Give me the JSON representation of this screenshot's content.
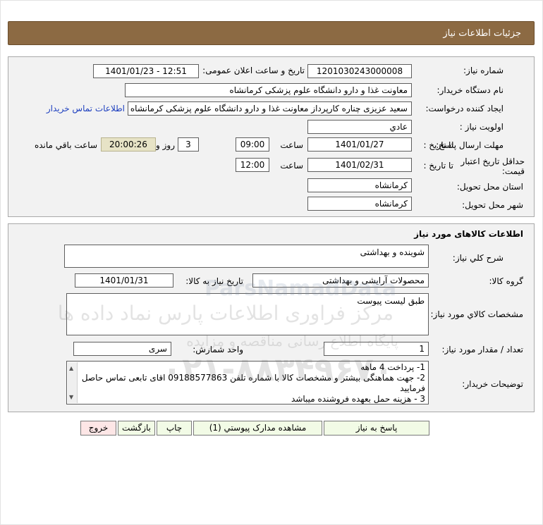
{
  "header": {
    "title": "جزئیات اطلاعات نیاز"
  },
  "info": {
    "need_number_label": "شماره نیاز:",
    "need_number": "1201030243000008",
    "announce_label": "تاریخ و ساعت اعلان عمومی:",
    "announce_value": "1401/01/23 - 12:51",
    "buyer_label": "نام دستگاه خریدار:",
    "buyer": "معاونت غذا و دارو دانشگاه علوم پزشکی کرمانشاه",
    "creator_label": "ایجاد کننده درخواست:",
    "creator": "سعید عزیزی چناره کارپرداز معاونت غذا و دارو دانشگاه علوم پزشکی کرمانشاه",
    "contact_link": "اطلاعات تماس خریدار",
    "priority_label": "اولویت نیاز :",
    "priority": "عادي",
    "deadline_label": "مهلت ارسال پاسخ:",
    "to_date_label": "تا تاریخ :",
    "deadline_date": "1401/01/27",
    "time_label": "ساعت",
    "deadline_time": "09:00",
    "days_value": "3",
    "days_label": "روز و",
    "remaining_time": "20:00:26",
    "remaining_label": "ساعت باقي مانده",
    "validity_label_1": "حداقل تاریخ اعتبار",
    "validity_label_2": "قیمت:",
    "validity_to_label": "تا تاریخ :",
    "validity_date": "1401/02/31",
    "validity_time_label": "ساعت",
    "validity_time": "12:00",
    "province_label": "استان محل تحویل:",
    "province": "کرمانشاه",
    "city_label": "شهر محل تحویل:",
    "city": "کرمانشاه"
  },
  "goods": {
    "title": "اطلاعات کالاهای مورد نیاز",
    "summary_label": "شرح کلي نیاز:",
    "summary": "شوینده و بهداشتی",
    "group_label": "گروه کالا:",
    "group": "محصولات آرایشی و بهداشتی",
    "need_date_label": "تاریخ نیاز به کالا:",
    "need_date": "1401/01/31",
    "specs_label": "مشخصات کالاي مورد نیاز:",
    "specs": "طبق لیست پیوست",
    "qty_label": "تعداد / مقدار مورد نیاز:",
    "qty": "1",
    "unit_label": "واحد شمارش:",
    "unit": "سری",
    "notes_label": "توضیحات خریدار:",
    "notes": [
      "1- پرداخت 4 ماهه",
      "2- جهت هماهنگی بیشتر و مشخصات کالا با شماره تلفن 09188577863 اقای تابعی  تماس حاصل فرمایید",
      "3 - هزینه حمل بعهده فروشنده میباشد"
    ]
  },
  "buttons": {
    "reply": "پاسخ به نیاز",
    "attachments": "مشاهده مدارک پیوستي (1)",
    "print": "چاپ",
    "back": "بازگشت",
    "exit": "خروج"
  },
  "watermark": {
    "line1": "مرکز فراوری اطلاعات پارس نماد داده ها",
    "line2": "پایگاه اطلاع رسانی مناقصه و مزایده",
    "phone": "۰۲۱-۸۸۳۴۹۶۷۰",
    "brand": "ParsNamadData"
  },
  "colors": {
    "header_bg": "#8c6a43",
    "panel_bg": "#f2f2f2",
    "button_bg": "#f2fbe6",
    "exit_bg": "#fde6e6",
    "link": "#1d3fbf",
    "remaining_bg": "#e7e3c6"
  }
}
